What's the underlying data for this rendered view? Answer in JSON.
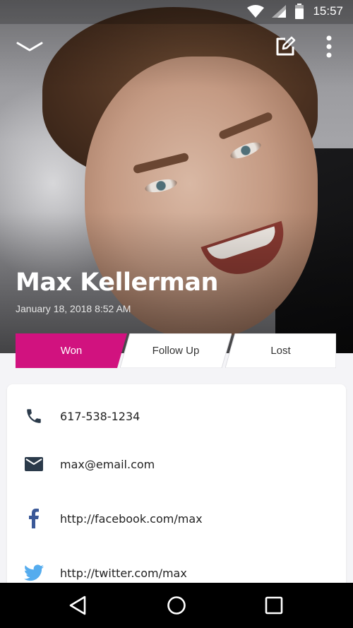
{
  "status_bar": {
    "time": "15:57",
    "icons": [
      "wifi-icon",
      "signal-icon",
      "battery-icon"
    ]
  },
  "toolbar": {
    "collapse_icon": "chevron-down-icon",
    "edit_icon": "edit-icon",
    "more_icon": "more-vert-icon"
  },
  "contact": {
    "name": "Max Kellerman",
    "date": "January 18, 2018 8:52 AM"
  },
  "status_options": [
    {
      "label": "Won",
      "selected": true
    },
    {
      "label": "Follow Up",
      "selected": false
    },
    {
      "label": "Lost",
      "selected": false
    }
  ],
  "details": {
    "phone": {
      "icon": "phone-icon",
      "value": "617-538-1234"
    },
    "email": {
      "icon": "mail-icon",
      "value": "max@email.com"
    },
    "facebook": {
      "icon": "facebook-icon",
      "value": "http://facebook.com/max"
    },
    "twitter": {
      "icon": "twitter-icon",
      "value": "http://twitter.com/max"
    }
  },
  "nav_bar": [
    "back-icon",
    "home-icon",
    "recents-icon"
  ],
  "colors": {
    "accent": "#d1127f",
    "icon": "#2b3a4a",
    "facebook": "#3b5998",
    "twitter": "#55acee",
    "background": "#f4f4f7"
  }
}
